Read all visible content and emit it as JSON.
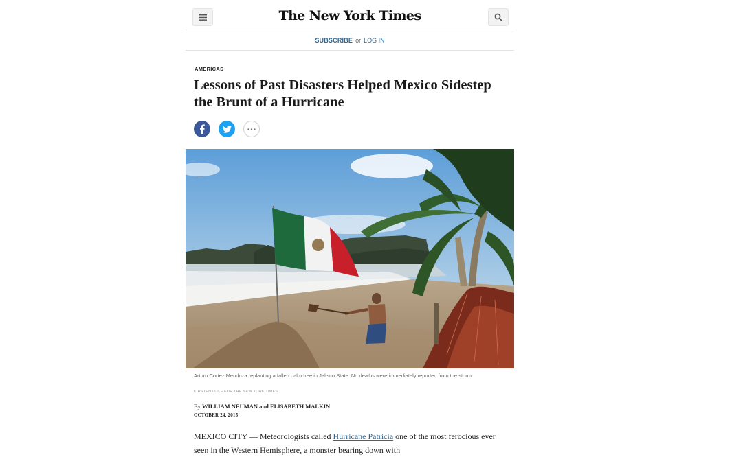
{
  "header": {
    "logo": "The New York Times",
    "menu_icon": "hamburger-menu-icon",
    "search_icon": "search-icon"
  },
  "subscribe_bar": {
    "subscribe": "SUBSCRIBE",
    "or": "or",
    "login": "LOG IN"
  },
  "article": {
    "kicker": "AMERICAS",
    "headline": "Lessons of Past Disasters Helped Mexico Sidestep the Brunt of a Hurricane",
    "share": {
      "facebook_icon": "facebook-icon",
      "twitter_icon": "twitter-icon",
      "more_icon": "more-ellipsis-icon"
    },
    "photo_caption": "Arturo Cortez Mendoza replanting a fallen palm tree in Jalisco State. No deaths were immediately reported from the storm.",
    "photo_credit": "KIRSTEN LUCE FOR THE NEW YORK TIMES",
    "byline_prefix": "By",
    "author1": "WILLIAM NEUMAN",
    "and": "and",
    "author2": "ELISABETH MALKIN",
    "date": "OCTOBER 24, 2015",
    "body_lead": "MEXICO CITY — Meteorologists called",
    "body_link": "Hurricane Patricia",
    "body_rest": "one of the most ferocious ever seen in the Western Hemisphere, a monster bearing down with"
  },
  "colors": {
    "link": "#326891",
    "facebook": "#3b5998",
    "twitter": "#1da1f2"
  }
}
